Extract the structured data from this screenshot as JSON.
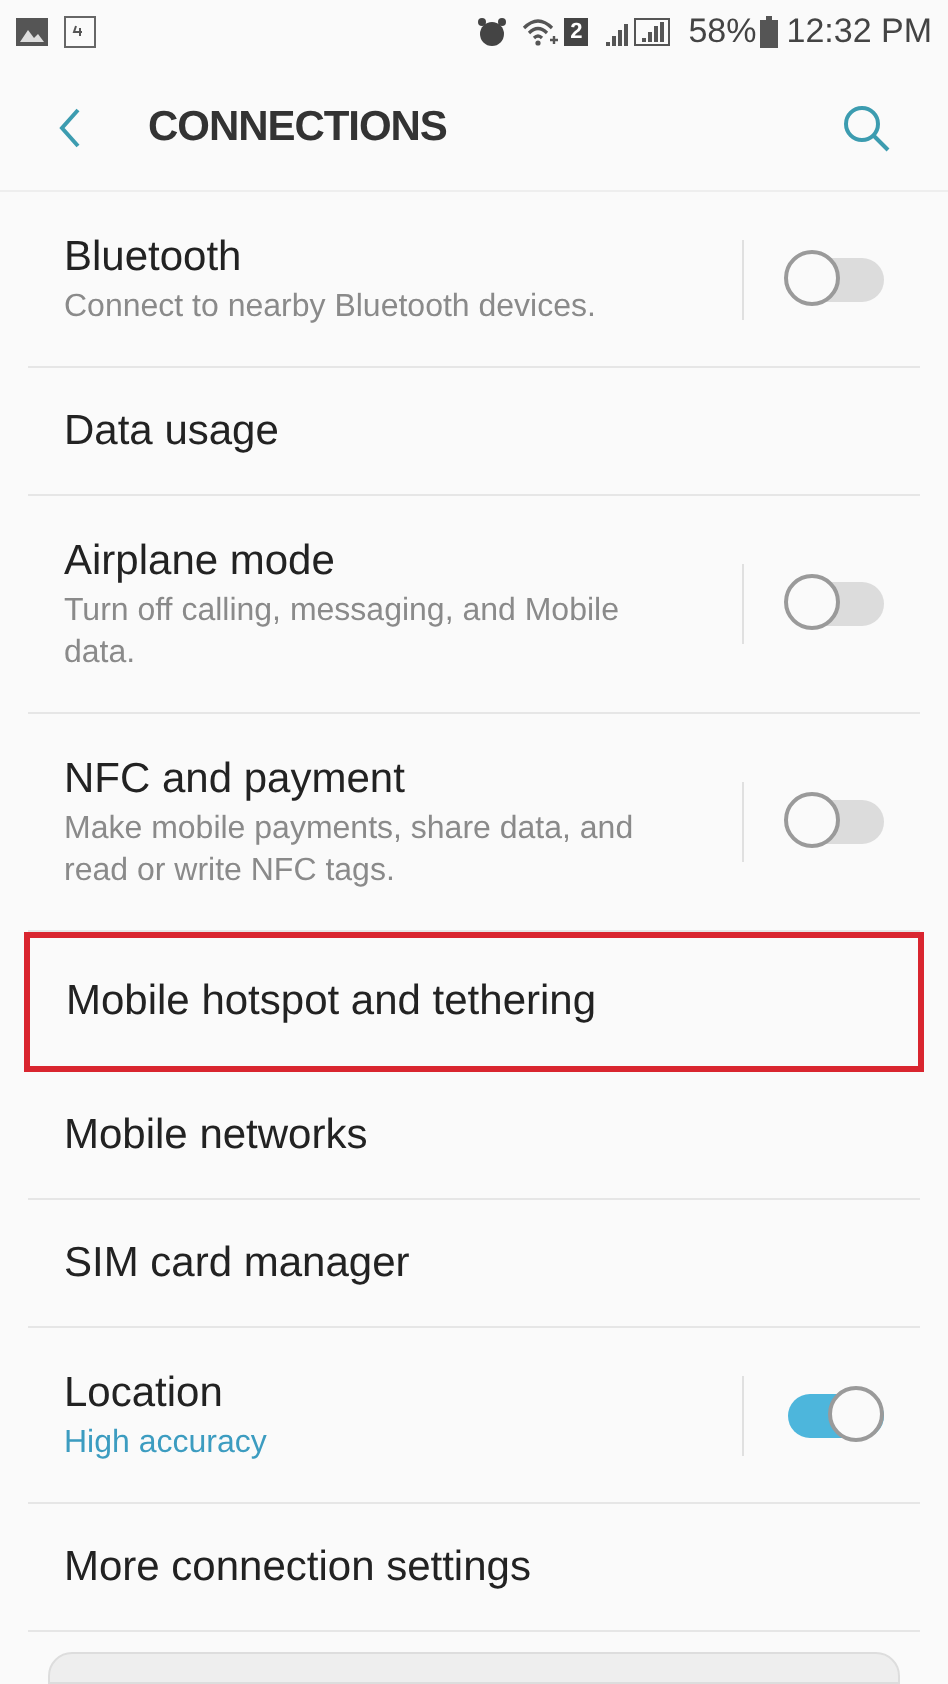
{
  "status_bar": {
    "sim_badge": "2",
    "battery": "58%",
    "time": "12:32 PM"
  },
  "header": {
    "title": "CONNECTIONS"
  },
  "items": [
    {
      "kind": "toggle",
      "title": "Bluetooth",
      "subtitle": "Connect to nearby Bluetooth devices.",
      "on": false,
      "highlighted": false
    },
    {
      "kind": "plain",
      "title": "Data usage",
      "highlighted": false
    },
    {
      "kind": "toggle",
      "title": "Airplane mode",
      "subtitle": "Turn off calling, messaging, and Mobile data.",
      "on": false,
      "highlighted": false
    },
    {
      "kind": "toggle",
      "title": "NFC and payment",
      "subtitle": "Make mobile payments, share data, and read or write NFC tags.",
      "on": false,
      "highlighted": false
    },
    {
      "kind": "plain",
      "title": "Mobile hotspot and tethering",
      "highlighted": true
    },
    {
      "kind": "plain",
      "title": "Mobile networks",
      "highlighted": false
    },
    {
      "kind": "plain",
      "title": "SIM card manager",
      "highlighted": false
    },
    {
      "kind": "toggle",
      "title": "Location",
      "subtitle": "High accuracy",
      "subtitle_accent": true,
      "on": true,
      "highlighted": false
    },
    {
      "kind": "plain",
      "title": "More connection settings",
      "highlighted": false
    }
  ]
}
